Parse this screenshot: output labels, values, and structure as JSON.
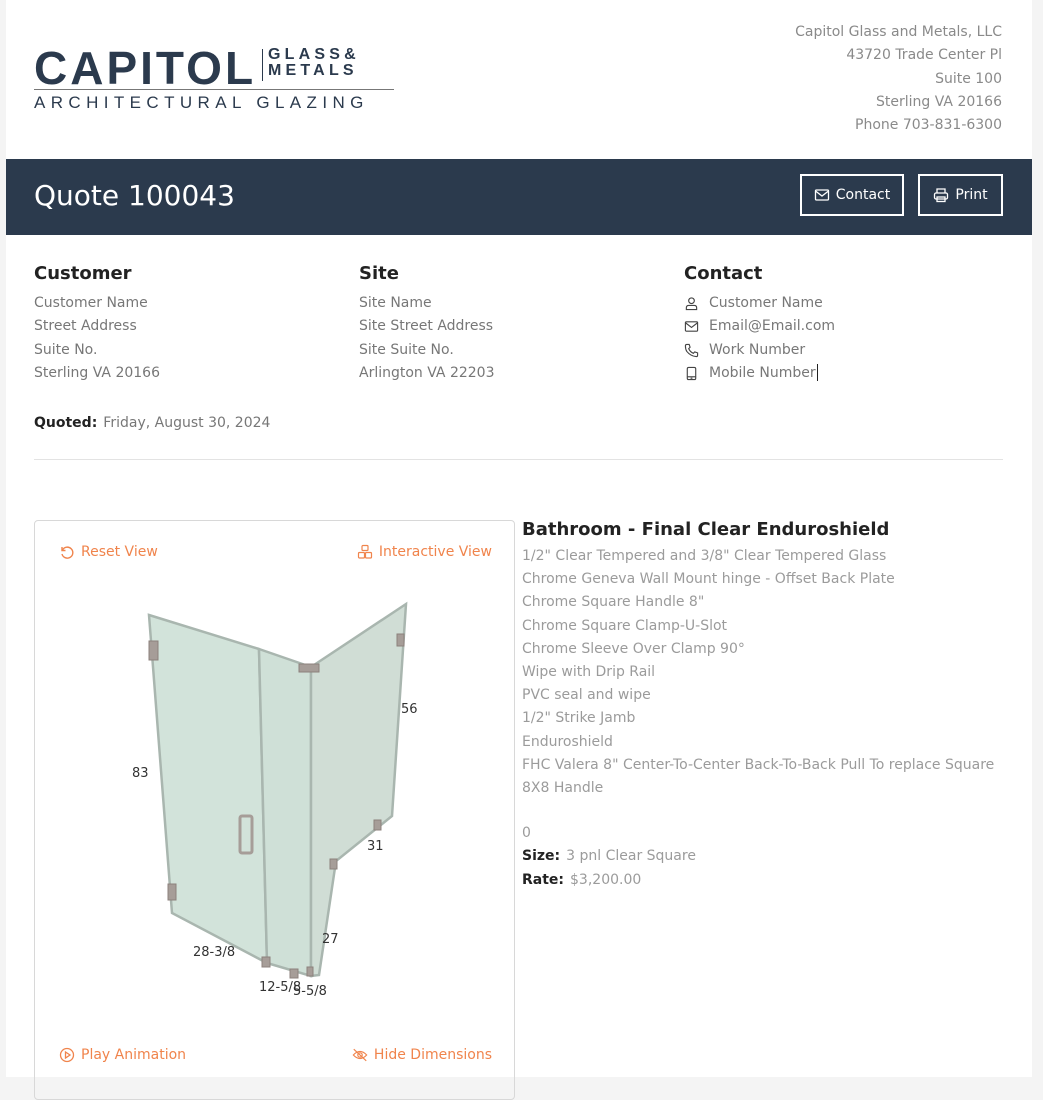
{
  "logo": {
    "main": "CAPITOL",
    "side_top": "GLASS&",
    "side_bottom": "METALS",
    "tagline": "ARCHITECTURAL GLAZING"
  },
  "company": {
    "name": "Capitol Glass and Metals, LLC",
    "street": "43720 Trade Center Pl",
    "suite": "Suite 100",
    "city": "Sterling VA 20166",
    "phone": "Phone 703-831-6300"
  },
  "titlebar": {
    "title": "Quote 100043",
    "contact_label": "Contact",
    "print_label": "Print",
    "bg_color": "#2b3a4d"
  },
  "customer": {
    "heading": "Customer",
    "lines": [
      "Customer Name",
      "Street Address",
      "Suite No.",
      "Sterling VA 20166"
    ]
  },
  "site": {
    "heading": "Site",
    "lines": [
      "Site Name",
      "Site Street Address",
      "Site Suite No.",
      "Arlington VA 22203"
    ]
  },
  "contact": {
    "heading": "Contact",
    "name": {
      "icon": "user-icon",
      "text": "Customer Name"
    },
    "email": {
      "icon": "envelope-icon",
      "text": "Email@Email.com"
    },
    "work": {
      "icon": "phone-icon",
      "text": "Work Number"
    },
    "mobile": {
      "icon": "mobile-icon",
      "text": "Mobile Number"
    }
  },
  "quoted": {
    "label": "Quoted:",
    "value": "Friday, August 30, 2024"
  },
  "viewer": {
    "accent_color": "#f0844c",
    "reset_view": "Reset View",
    "interactive_view": "Interactive View",
    "play_animation": "Play Animation",
    "hide_dimensions": "Hide Dimensions",
    "dimensions": {
      "height_left": "83",
      "height_right": "56",
      "notch_top": "31",
      "notch_height": "27",
      "base_left": "28-3/8",
      "base_mid": "12-5/8",
      "base_return": "5-5/8"
    }
  },
  "item": {
    "title": "Bathroom - Final Clear Enduroshield",
    "lines": [
      "1/2\" Clear Tempered and 3/8\" Clear Tempered Glass",
      "Chrome Geneva Wall Mount hinge - Offset Back Plate",
      "Chrome Square Handle 8\"",
      "Chrome Square Clamp-U-Slot",
      "Chrome Sleeve Over Clamp 90°",
      "Wipe with Drip Rail",
      "PVC seal and wipe",
      "1/2\" Strike Jamb",
      "Enduroshield",
      "FHC Valera 8\" Center-To-Center Back-To-Back Pull To replace Square 8X8 Handle"
    ],
    "quantity": "0",
    "size_label": "Size:",
    "size_value": "3 pnl Clear Square",
    "rate_label": "Rate:",
    "rate_value": "$3,200.00"
  }
}
